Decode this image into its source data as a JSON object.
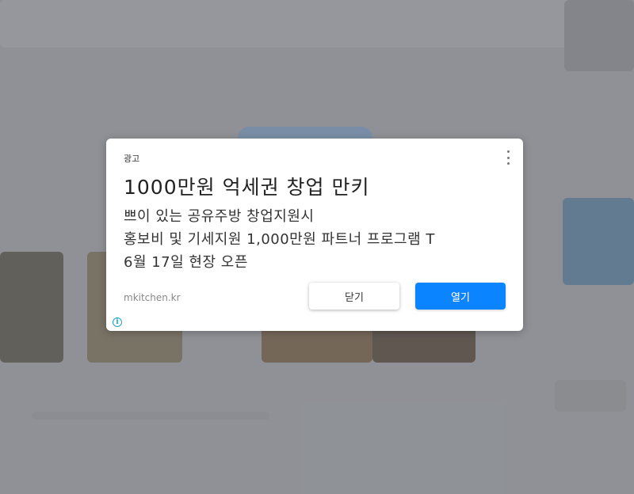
{
  "ad_dialog": {
    "ad_label": "광고",
    "headline": "1000만원 억세권 창업 만키",
    "body_lines": [
      "쁘이 있는 공유주방 창업지원시",
      "홍보비 및 기세지원 1,000만원 파트너 프로그램 T",
      "6월 17일 현장 오픈"
    ],
    "domain": "mkitchen.kr",
    "close_label": "닫기",
    "open_label": "열기",
    "menu_icon": "more-vertical-icon",
    "info_icon": "info-icon",
    "info_glyph": "i"
  },
  "colors": {
    "accent": "#0b84ff",
    "info": "#1aa5c8",
    "backdrop": "#8f9296"
  }
}
